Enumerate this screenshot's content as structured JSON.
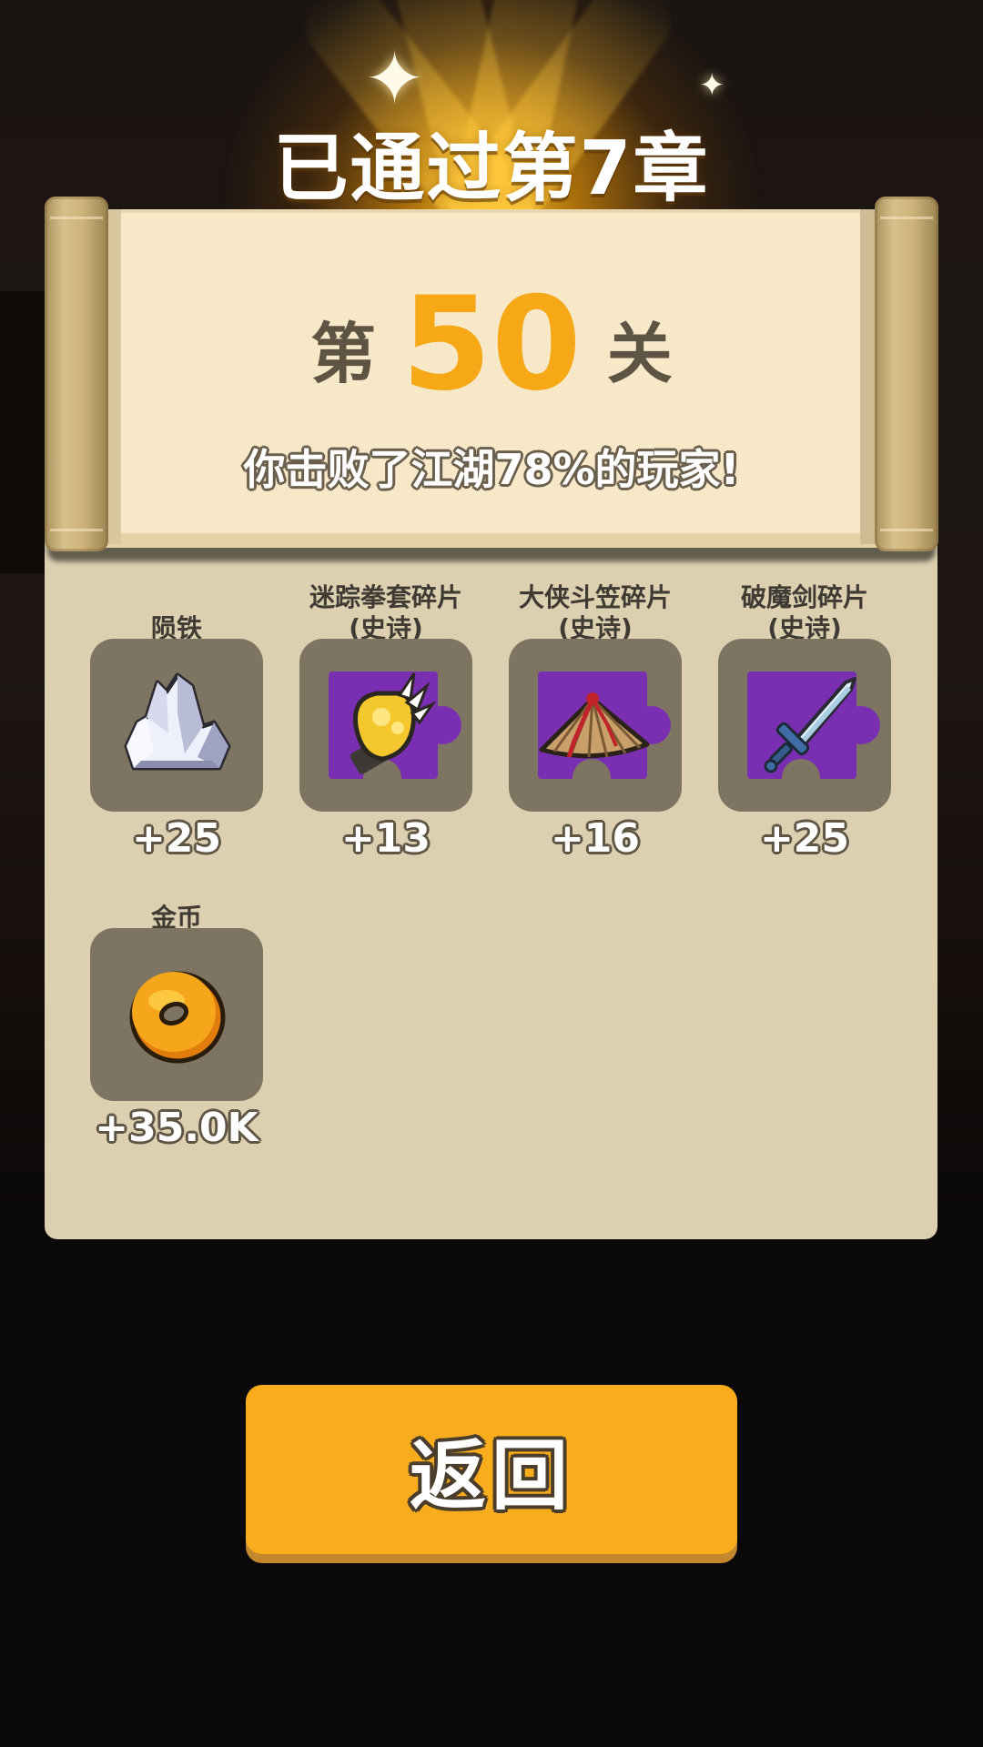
{
  "header": {
    "chapter_title": "已通过第7章"
  },
  "level": {
    "prefix": "第",
    "number": "50",
    "suffix": "关"
  },
  "result_text": "你击败了江湖78%的玩家!",
  "rewards": [
    {
      "name": "陨铁",
      "rarity": "",
      "count": "+25",
      "icon": "meteoric-iron-crystal-icon"
    },
    {
      "name": "迷踪拳套碎片",
      "rarity": "(史诗)",
      "count": "+13",
      "icon": "gauntlet-fragment-icon"
    },
    {
      "name": "大侠斗笠碎片",
      "rarity": "(史诗)",
      "count": "+16",
      "icon": "bamboo-hat-fragment-icon"
    },
    {
      "name": "破魔剑碎片",
      "rarity": "(史诗)",
      "count": "+25",
      "icon": "sword-fragment-icon"
    },
    {
      "name": "金币",
      "rarity": "",
      "count": "+35.0K",
      "icon": "gold-coin-icon"
    }
  ],
  "return_button": {
    "label": "返回"
  },
  "colors": {
    "accent_orange": "#f9ad1d",
    "level_number": "#f6a817",
    "epic_purple": "#7a2fb3",
    "panel": "#ddd0b0"
  }
}
